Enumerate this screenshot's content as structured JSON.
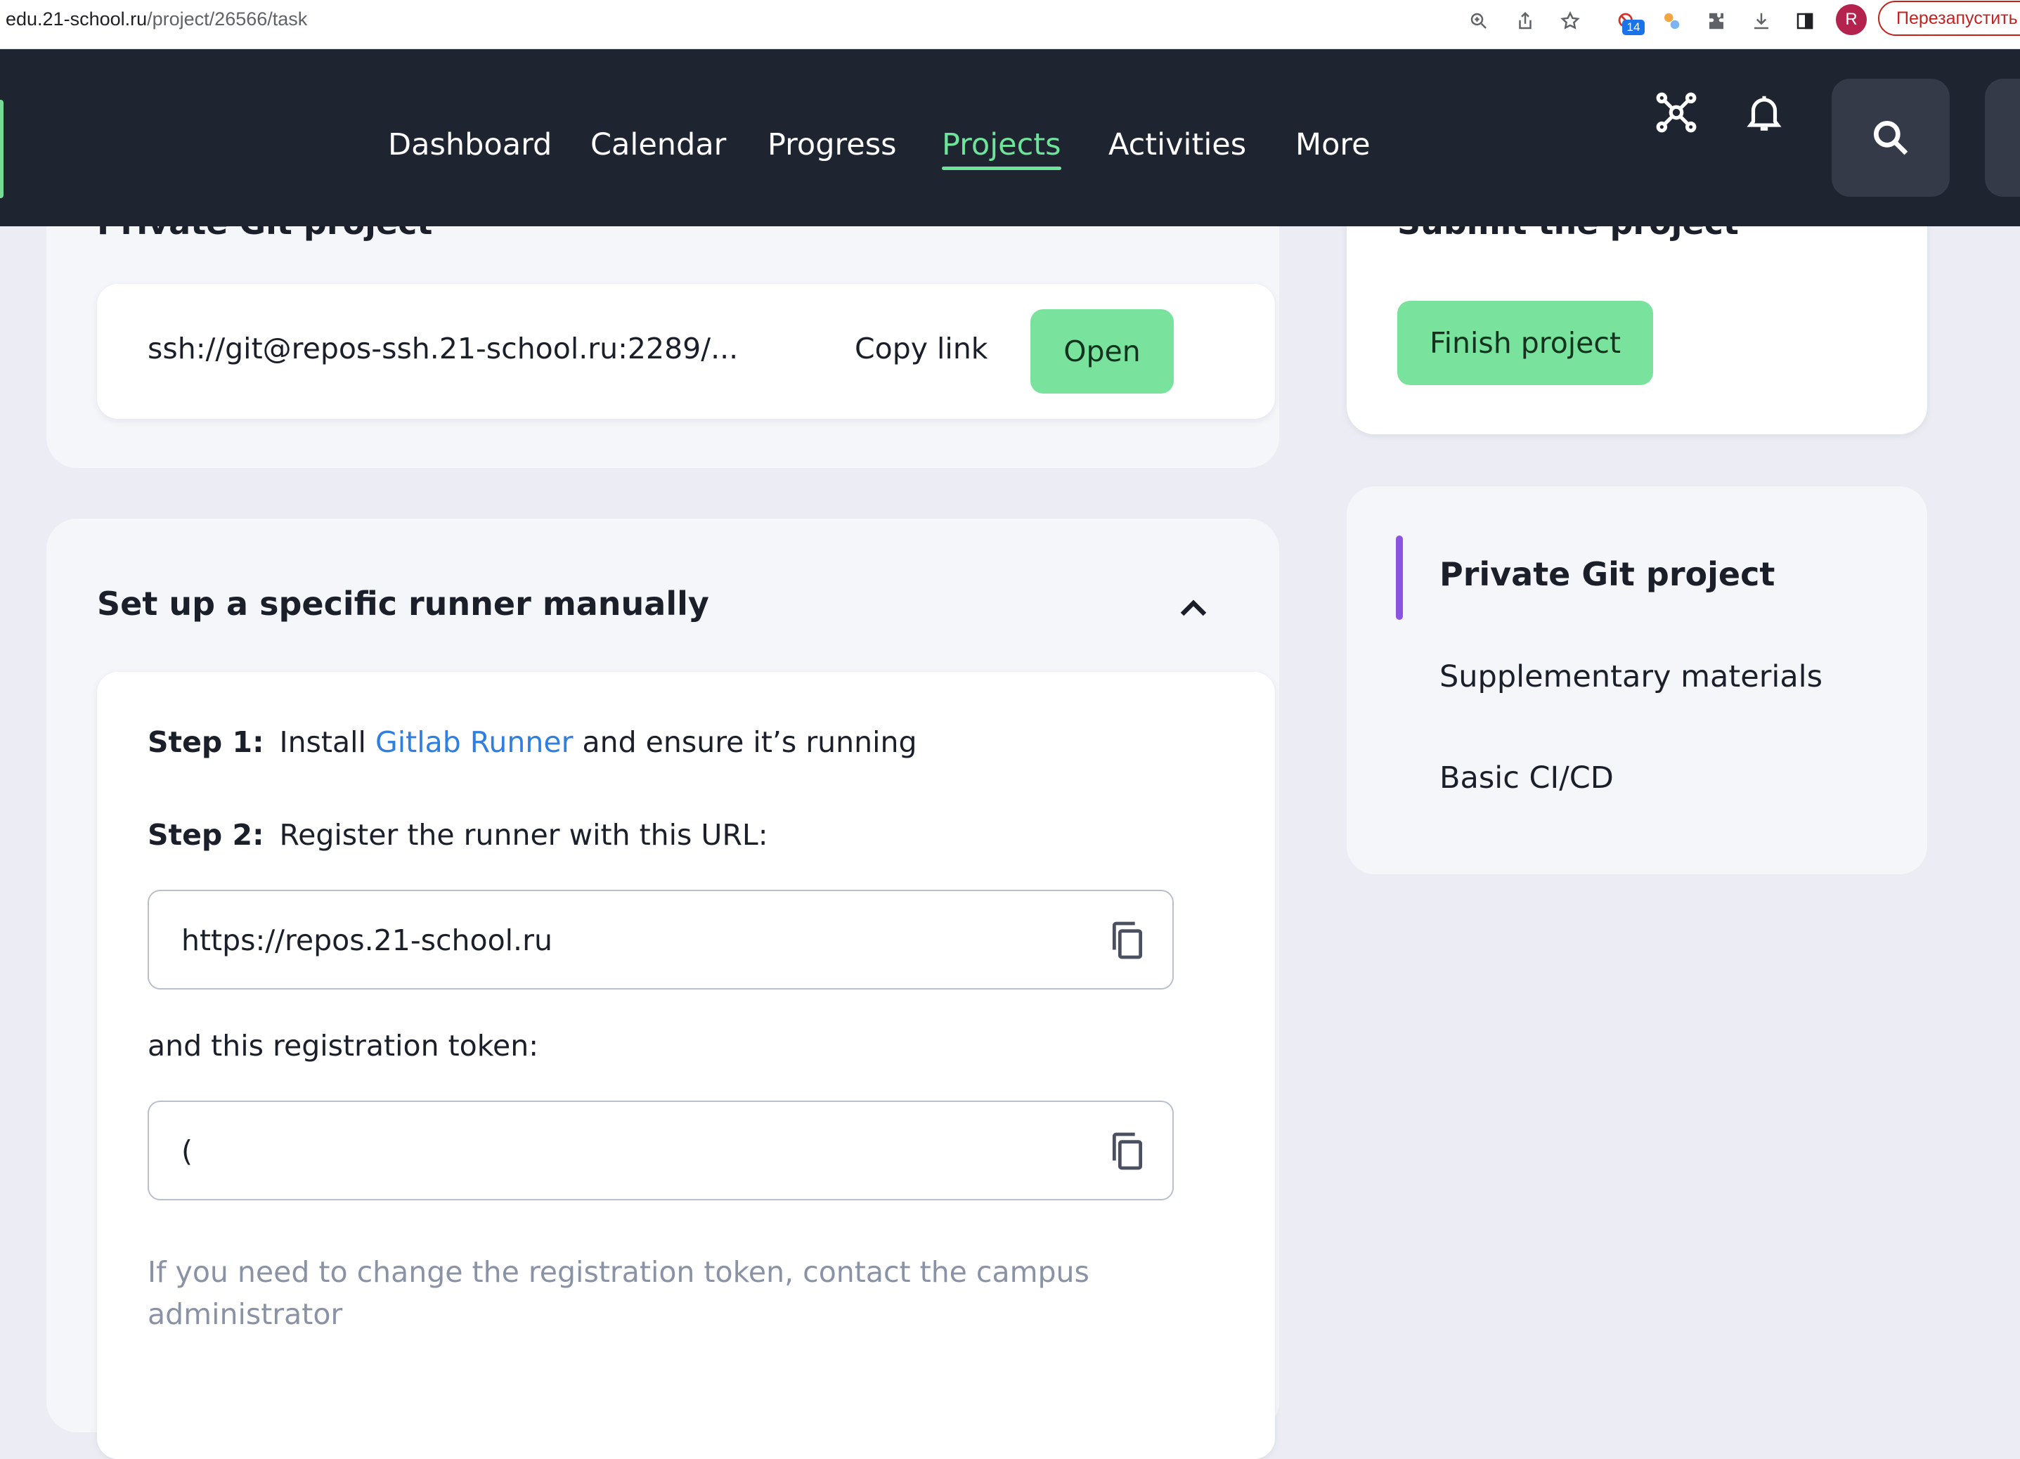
{
  "browser": {
    "url_host": "edu.21-school.ru",
    "url_path": "/project/26566/task",
    "extension_badge": "14",
    "profile_initial": "R",
    "relaunch_label": "Перезапустить"
  },
  "header": {
    "nav": [
      {
        "label": "Dashboard"
      },
      {
        "label": "Calendar"
      },
      {
        "label": "Progress"
      },
      {
        "label": "Projects"
      },
      {
        "label": "Activities"
      },
      {
        "label": "More"
      }
    ],
    "active_nav": "Projects"
  },
  "git_section": {
    "title": "Private Git project",
    "ssh_link": "ssh://git@repos-ssh.21-school.ru:2289/...",
    "copy_label": "Copy link",
    "open_label": "Open"
  },
  "submit_section": {
    "title": "Submit the project",
    "finish_label": "Finish project"
  },
  "runner_section": {
    "title": "Set up a specific runner manually",
    "step1_label": "Step 1:",
    "step1_pre": "Install",
    "step1_link": "Gitlab Runner",
    "step1_post": "and ensure it’s running",
    "step2_label": "Step 2:",
    "step2_text": "Register the runner with this URL:",
    "url_value": "https://repos.21-school.ru",
    "token_intro": "and this registration token:",
    "token_value": "(",
    "note": "If you need to change the registration token, contact the campus administrator"
  },
  "sidebar": {
    "items": [
      {
        "label": "Private Git project"
      },
      {
        "label": "Supplementary materials"
      },
      {
        "label": "Basic CI/CD"
      }
    ]
  },
  "colors": {
    "accent_green": "#6ee39a",
    "button_green": "#79e39d",
    "link_blue": "#2f7fe0",
    "sidebar_accent": "#8b54e0",
    "header_bg": "#1f2431"
  }
}
